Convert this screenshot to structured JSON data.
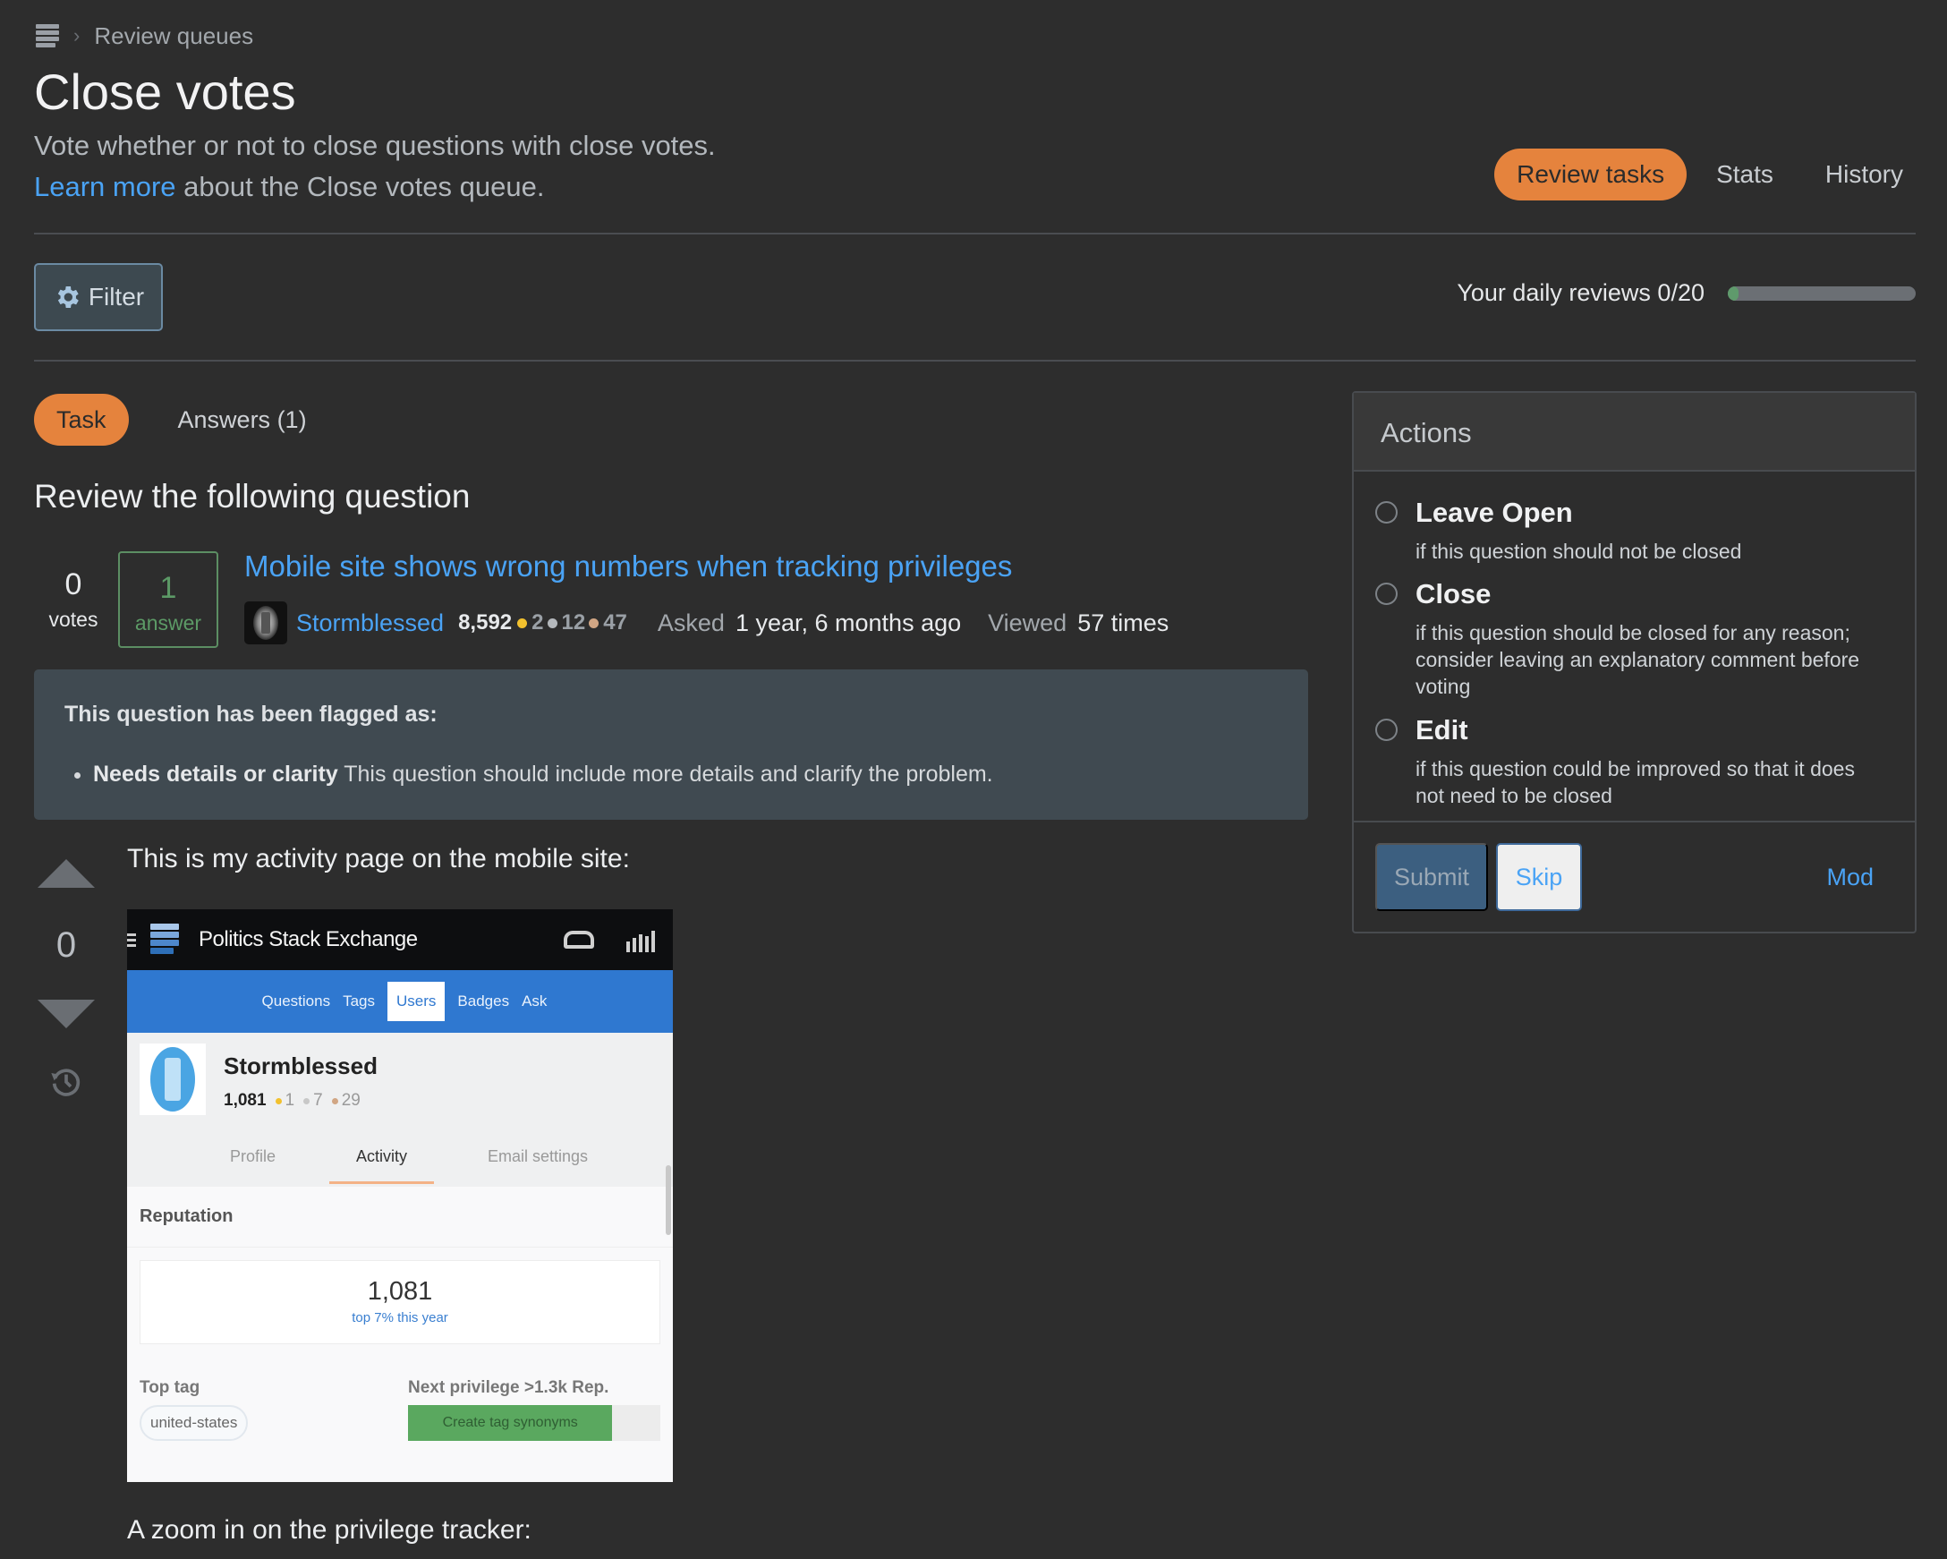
{
  "breadcrumb": {
    "icon": "stack-exchange-logo-icon",
    "separator_icon": "chevron-right-icon",
    "label": "Review queues"
  },
  "header": {
    "title": "Close votes",
    "subtitle": "Vote whether or not to close questions with close votes.",
    "learn_more_link": "Learn more",
    "learn_more_rest": " about the Close votes queue."
  },
  "topnav": {
    "items": [
      {
        "label": "Review tasks",
        "active": true
      },
      {
        "label": "Stats",
        "active": false
      },
      {
        "label": "History",
        "active": false
      }
    ],
    "accent_color": "#e5833d"
  },
  "filter": {
    "label": "Filter",
    "icon": "gear-icon"
  },
  "daily_reviews": {
    "label": "Your daily reviews 0/20",
    "done": 0,
    "total": 20,
    "progress_fraction": 0.0
  },
  "tabs": [
    {
      "label": "Task",
      "active": true
    },
    {
      "label": "Answers (1)",
      "active": false
    }
  ],
  "review_heading": "Review the following question",
  "question": {
    "votes": "0",
    "votes_label": "votes",
    "answers": "1",
    "answers_label": "answer",
    "title": "Mobile site shows wrong numbers when tracking privileges",
    "author": "Stormblessed",
    "reputation": "8,592",
    "badges": {
      "gold": "2",
      "silver": "12",
      "bronze": "47"
    },
    "asked_label": "Asked",
    "asked_value": "1 year, 6 months ago",
    "viewed_label": "Viewed",
    "viewed_value": "57 times"
  },
  "flag": {
    "heading": "This question has been flagged as:",
    "items": [
      {
        "reason": "Needs details or clarity",
        "description": " This question should include more details and clarify the problem."
      }
    ]
  },
  "post": {
    "score": "0",
    "paragraph1": "This is my activity page on the mobile site:",
    "paragraph2": "A zoom in on the privilege tracker:",
    "screenshot": {
      "site_name": "Politics Stack Exchange",
      "nav": [
        "Questions",
        "Tags",
        "Users",
        "Badges",
        "Ask"
      ],
      "nav_selected": "Users",
      "user_name": "Stormblessed",
      "rep": "1,081",
      "badges": {
        "gold": "1",
        "silver": "7",
        "bronze": "29"
      },
      "profile_tabs": [
        "Profile",
        "Activity",
        "Email settings"
      ],
      "profile_tab_active": "Activity",
      "section_title": "Reputation",
      "rep_big": "1,081",
      "rep_rank": "top 7% this year",
      "top_tag_label": "Top tag",
      "top_tag": "united-states",
      "next_priv_label": "Next privilege >1.3k Rep.",
      "next_priv_name": "Create tag synonyms",
      "next_priv_progress": 0.81
    }
  },
  "actions": {
    "title": "Actions",
    "options": [
      {
        "label": "Leave Open",
        "description": "if this question should not be closed"
      },
      {
        "label": "Close",
        "description": "if this question should be closed for any reason; consider leaving an explanatory comment before voting"
      },
      {
        "label": "Edit",
        "description": "if this question could be improved so that it does not need to be closed"
      }
    ],
    "submit": "Submit",
    "skip": "Skip",
    "mod": "Mod"
  }
}
